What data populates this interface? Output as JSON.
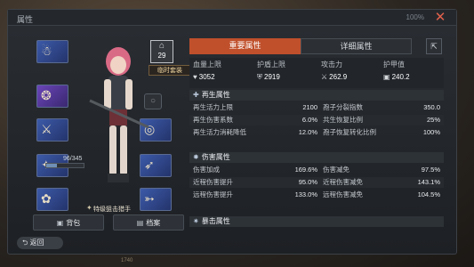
{
  "window": {
    "title": "属性",
    "status": "100%",
    "close_icon": "close-icon"
  },
  "character": {
    "level": "29",
    "level_icon": "building-icon",
    "suit_label": "临时套装",
    "hp_text": "96/345",
    "hp_fraction": 0.28,
    "class_label": "特级狙击猎手"
  },
  "slots": [
    {
      "name": "slot-helmet",
      "glyph": "☃",
      "tag": "",
      "color": "blue"
    },
    {
      "name": "slot-necklace",
      "glyph": "❂",
      "tag": "",
      "color": "purple"
    },
    {
      "name": "slot-rifle",
      "glyph": "⚔",
      "tag": "",
      "color": "blue"
    },
    {
      "name": "slot-pistol",
      "glyph": "✦",
      "tag": "",
      "color": "blue"
    },
    {
      "name": "slot-grenade",
      "glyph": "✿",
      "tag": "",
      "color": "blue"
    },
    {
      "name": "slot-bracelet",
      "glyph": "◎",
      "tag": "",
      "color": "blue"
    },
    {
      "name": "slot-sniper",
      "glyph": "➶",
      "tag": "",
      "color": "blue"
    },
    {
      "name": "slot-shotgun",
      "glyph": "➳",
      "tag": "",
      "color": "blue"
    },
    {
      "name": "slot-gadget",
      "glyph": "✵",
      "tag": "",
      "color": "blue"
    }
  ],
  "buttons": {
    "bag": "背包",
    "profile": "档案",
    "back": "返回"
  },
  "tabs": {
    "main": "重要属性",
    "detail": "详细属性"
  },
  "summary": [
    {
      "label": "血量上限",
      "value": "3052",
      "icon": "heart-icon",
      "glyph": "♥"
    },
    {
      "label": "护盾上限",
      "value": "2919",
      "icon": "shield-icon",
      "glyph": "⛨"
    },
    {
      "label": "攻击力",
      "value": "262.9",
      "icon": "sword-icon",
      "glyph": "⚔"
    },
    {
      "label": "护甲值",
      "value": "240.2",
      "icon": "armor-icon",
      "glyph": "▣"
    }
  ],
  "sections": [
    {
      "title": "再生属性",
      "icon": "regen-icon",
      "glyph": "✚",
      "rows": [
        [
          "再生活力上限",
          "2100",
          "孢子分裂指数",
          "350.0"
        ],
        [
          "再生伤害系数",
          "6.0%",
          "共生恢复比例",
          "25%"
        ],
        [
          "再生活力消耗降低",
          "12.0%",
          "孢子恢复转化比例",
          "100%"
        ]
      ]
    },
    {
      "title": "伤害属性",
      "icon": "damage-icon",
      "glyph": "✸",
      "rows": [
        [
          "伤害加成",
          "169.6%",
          "伤害减免",
          "97.5%"
        ],
        [
          "近程伤害提升",
          "95.0%",
          "近程伤害减免",
          "143.1%"
        ],
        [
          "远程伤害提升",
          "133.0%",
          "远程伤害减免",
          "104.5%"
        ]
      ]
    },
    {
      "title": "暴击属性",
      "icon": "crit-icon",
      "glyph": "✷",
      "rows": []
    }
  ],
  "footer_number": "1740"
}
